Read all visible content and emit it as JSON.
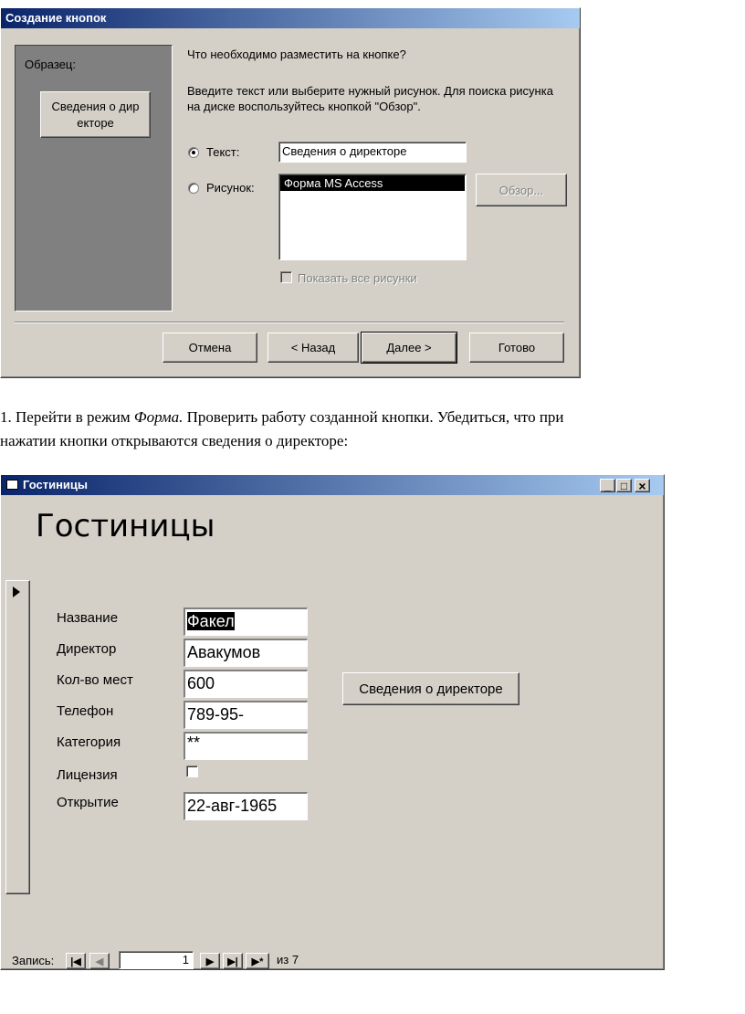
{
  "wizard": {
    "title": "Создание кнопок",
    "sample_label": "Образец:",
    "sample_button": "Сведения о дир екторе",
    "question": "Что необходимо разместить на кнопке?",
    "instruction": "Введите текст или выберите нужный рисунок.  Для поиска рисунка на диске воспользуйтесь кнопкой \"Обзор\".",
    "text_option": "Текст:",
    "text_value": "Сведения о директоре",
    "picture_option": "Рисунок:",
    "picture_list": [
      "Форма MS Access"
    ],
    "browse_button": "Обзор...",
    "show_all_pictures": "Показать все рисунки",
    "buttons": {
      "cancel": "Отмена",
      "back": "< Назад",
      "next": "Далее >",
      "finish": "Готово"
    }
  },
  "doc": {
    "line1_prefix": "1. Перейти в режим ",
    "line1_italic": "Форма.",
    "line1_suffix": " Проверить работу созданной кнопки. Убедиться, что при",
    "line2": "нажатии кнопки открываются сведения о директоре:"
  },
  "form": {
    "window_title": "Гостиницы",
    "header": "Гостиницы",
    "fields": [
      {
        "label": "Название",
        "value": "Факел"
      },
      {
        "label": "Директор",
        "value": "Авакумов"
      },
      {
        "label": "Кол-во мест",
        "value": "600"
      },
      {
        "label": "Телефон",
        "value": "789-95-"
      },
      {
        "label": "Категория",
        "value": "**"
      },
      {
        "label": "Лицензия",
        "value": ""
      },
      {
        "label": "Открытие",
        "value": "22-авг-1965"
      }
    ],
    "license_checked": false,
    "director_button": "Сведения о директоре",
    "record_label": "Запись:",
    "record_number": "1",
    "record_total": "из  7",
    "window_controls": {
      "minimize": "_",
      "maximize": "□",
      "close": "×"
    }
  },
  "colors": {
    "window_bg": "#d4d0c8",
    "sample_panel": "#808080",
    "title_start": "#0a246a",
    "title_end": "#a6caf0",
    "selection": "#000000"
  }
}
